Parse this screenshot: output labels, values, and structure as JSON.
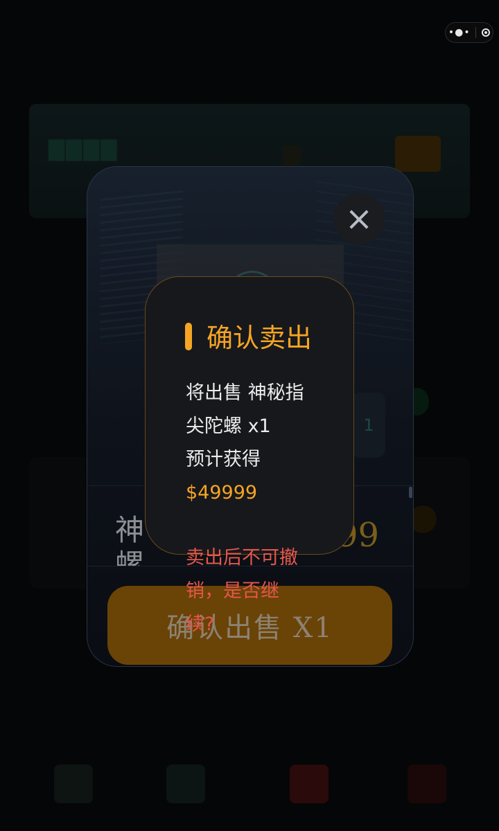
{
  "capsule": {
    "menu_icon": "more-dots-icon",
    "close_icon": "target-icon"
  },
  "detail": {
    "name_fragment": "神",
    "name_fragment_2": "螺",
    "price_fragment": "99",
    "qty_fragment": "1",
    "close_icon": "×",
    "sell_button_label": "确认出售 X1"
  },
  "confirm": {
    "title": "确认卖出",
    "line1": "将出售 神秘指",
    "line2": "尖陀螺 x1",
    "line3": "预计获得",
    "price": "$49999",
    "warning_line1": "卖出后不可撤",
    "warning_line2": "销，是否继",
    "warning_line3": "续?"
  },
  "colors": {
    "accent": "#f5a524",
    "warning": "#e4574c",
    "dialog_bg": "#17181c"
  }
}
